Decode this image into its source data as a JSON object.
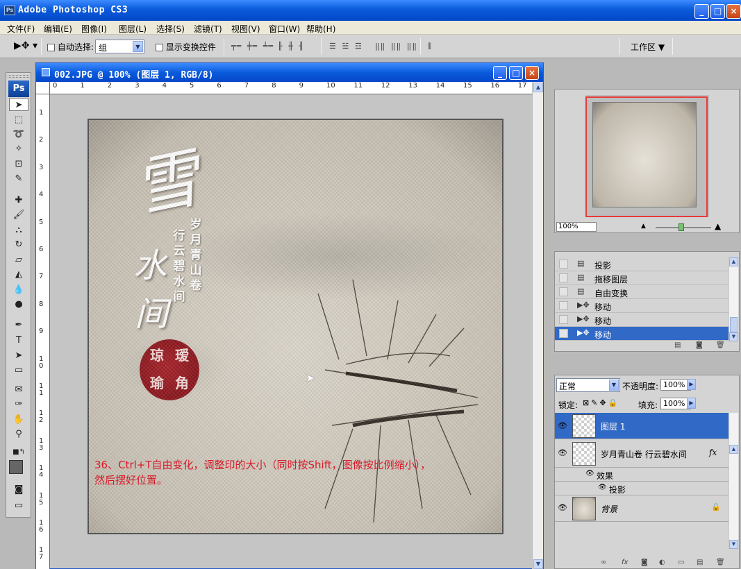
{
  "window": {
    "app_icon": "Ps",
    "title": "Adobe Photoshop CS3",
    "controls": [
      "_",
      "□",
      "×"
    ]
  },
  "menu": [
    "文件(F)",
    "编辑(E)",
    "图像(I)",
    "图层(L)",
    "选择(S)",
    "滤镜(T)",
    "视图(V)",
    "窗口(W)",
    "帮助(H)"
  ],
  "options": {
    "auto_select_label": "自动选择:",
    "auto_select_value": "组",
    "show_transform_label": "显示变换控件",
    "workspace_label": "工作区 ▼"
  },
  "toolbox": {
    "logo": "Ps",
    "tools": [
      "move-icon",
      "marquee-icon",
      "lasso-icon",
      "magic-wand-icon",
      "crop-icon",
      "slice-icon",
      "healing-brush-icon",
      "brush-icon",
      "clone-stamp-icon",
      "history-brush-icon",
      "eraser-icon",
      "paint-bucket-icon",
      "blur-icon",
      "dodge-icon",
      "pen-icon",
      "type-icon",
      "path-select-icon",
      "shape-icon",
      "notes-icon",
      "eyedropper-icon",
      "hand-icon",
      "zoom-icon",
      "swap-colors-icon",
      "foreground-color-swatch",
      "quick-mask-icon",
      "screen-mode-icon"
    ]
  },
  "document": {
    "title": "002.JPG @ 100% (图层 1, RGB/8)",
    "controls": [
      "_",
      "□",
      "×"
    ],
    "ruler_h": [
      "0",
      "1",
      "2",
      "3",
      "4",
      "5",
      "6",
      "7",
      "8",
      "9",
      "10",
      "11",
      "12",
      "13",
      "14",
      "15",
      "16",
      "17"
    ],
    "ruler_v": [
      "1",
      "2",
      "3",
      "4",
      "5",
      "6",
      "7",
      "8",
      "9",
      "1 0",
      "1 1",
      "1 2",
      "1 3",
      "1 4",
      "1 5",
      "1 6",
      "1 7"
    ]
  },
  "artwork": {
    "calligraphy_big": "雪",
    "calligraphy_small_1": "水",
    "calligraphy_small_2": "间",
    "vertical_col1": "岁月青山卷",
    "vertical_col2": "行云碧水间",
    "seal_chars": [
      "琼",
      "瑷",
      "瑜",
      "角"
    ]
  },
  "annotation": "36、Ctrl+T自由变化，调整印的大小（同时按Shift，图像按比例缩小），\n然后摆好位置。",
  "navigator": {
    "zoom": "100%"
  },
  "history": {
    "items": [
      {
        "icon": "history-state-icon",
        "label": "投影",
        "selected": false
      },
      {
        "icon": "history-state-icon",
        "label": "拖移图层",
        "selected": false
      },
      {
        "icon": "history-state-icon",
        "label": "自由变换",
        "selected": false
      },
      {
        "icon": "move-icon",
        "label": "移动",
        "selected": false
      },
      {
        "icon": "move-icon",
        "label": "移动",
        "selected": false
      },
      {
        "icon": "move-icon",
        "label": "移动",
        "selected": true
      }
    ]
  },
  "layers": {
    "blend_mode": "正常",
    "opacity_label": "不透明度:",
    "opacity_value": "100%",
    "lock_label": "锁定:",
    "fill_label": "填充:",
    "fill_value": "100%",
    "items": [
      {
        "name": "图层 1",
        "selected": true
      },
      {
        "name": "岁月青山卷 行云碧水间",
        "fx": "fx",
        "effects_label": "效果",
        "effect": "投影"
      },
      {
        "name": "背景",
        "locked": true
      }
    ]
  }
}
